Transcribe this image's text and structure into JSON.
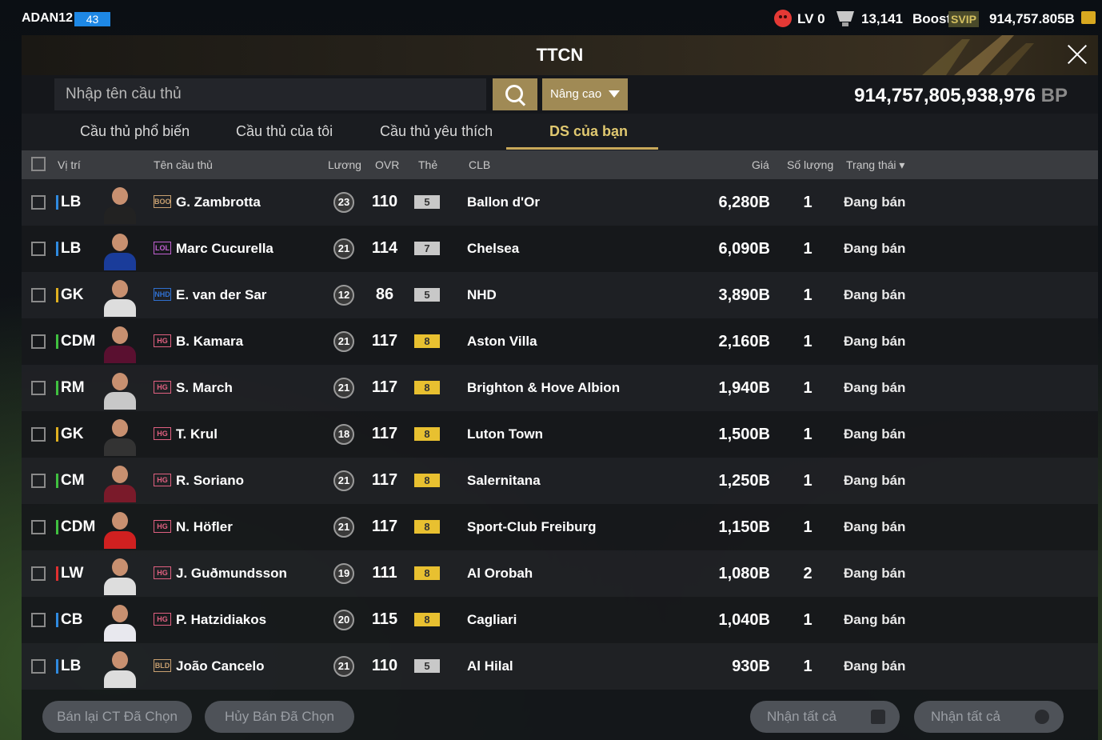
{
  "topbar": {
    "username": "ADAN12",
    "user_level": "43",
    "lv_text": "LV 0",
    "trophy_value": "13,141",
    "boost_label": "Boost",
    "svip_badge": "SVIP",
    "bp_balance": "914,757.805B",
    "icons": [
      "angry-face-icon",
      "trophy-icon",
      "bp-coin-icon"
    ]
  },
  "modal": {
    "title": "TTCN",
    "search": {
      "placeholder": "Nhập tên cầu thủ",
      "advanced_label": "Nâng cao",
      "bp_total": "914,757,805,938,976",
      "bp_unit": "BP"
    },
    "tabs": [
      {
        "label": "Cầu thủ phổ biến"
      },
      {
        "label": "Cầu thủ của tôi"
      },
      {
        "label": "Cầu thủ yêu thích"
      },
      {
        "label": "DS của bạn"
      }
    ],
    "active_tab": "DS của bạn",
    "columns": {
      "position": "Vị trí",
      "name": "Tên cầu thủ",
      "wage": "Lương",
      "ovr": "OVR",
      "card": "Thẻ",
      "club": "CLB",
      "price": "Giá",
      "quantity": "Số lượng",
      "status": "Trạng thái"
    },
    "rows": [
      {
        "position": "LB",
        "pos_color": "#2f8ae0",
        "season": "BOO",
        "season_color": "#c8a070",
        "name": "G. Zambrotta",
        "wage": "23",
        "ovr": "110",
        "card": "5",
        "card_color": "#c8c8c8",
        "club": "Ballon d'Or",
        "price": "6,280B",
        "qty": "1",
        "status": "Đang bán"
      },
      {
        "position": "LB",
        "pos_color": "#2f8ae0",
        "season": "LOL",
        "season_color": "#c060d0",
        "name": "Marc Cucurella",
        "wage": "21",
        "ovr": "114",
        "card": "7",
        "card_color": "#c8c8c8",
        "club": "Chelsea",
        "price": "6,090B",
        "qty": "1",
        "status": "Đang bán"
      },
      {
        "position": "GK",
        "pos_color": "#e0b020",
        "season": "NHD",
        "season_color": "#3070d0",
        "name": "E. van der Sar",
        "wage": "12",
        "ovr": "86",
        "card": "5",
        "card_color": "#c8c8c8",
        "club": "NHD",
        "price": "3,890B",
        "qty": "1",
        "status": "Đang bán"
      },
      {
        "position": "CDM",
        "pos_color": "#40c040",
        "season": "HG",
        "season_color": "#e06080",
        "name": "B. Kamara",
        "wage": "21",
        "ovr": "117",
        "card": "8",
        "card_color": "#e8c030",
        "club": "Aston Villa",
        "price": "2,160B",
        "qty": "1",
        "status": "Đang bán"
      },
      {
        "position": "RM",
        "pos_color": "#40c040",
        "season": "HG",
        "season_color": "#e06080",
        "name": "S. March",
        "wage": "21",
        "ovr": "117",
        "card": "8",
        "card_color": "#e8c030",
        "club": "Brighton & Hove Albion",
        "price": "1,940B",
        "qty": "1",
        "status": "Đang bán"
      },
      {
        "position": "GK",
        "pos_color": "#e0b020",
        "season": "HG",
        "season_color": "#e06080",
        "name": "T. Krul",
        "wage": "18",
        "ovr": "117",
        "card": "8",
        "card_color": "#e8c030",
        "club": "Luton Town",
        "price": "1,500B",
        "qty": "1",
        "status": "Đang bán"
      },
      {
        "position": "CM",
        "pos_color": "#40c040",
        "season": "HG",
        "season_color": "#e06080",
        "name": "R. Soriano",
        "wage": "21",
        "ovr": "117",
        "card": "8",
        "card_color": "#e8c030",
        "club": "Salernitana",
        "price": "1,250B",
        "qty": "1",
        "status": "Đang bán"
      },
      {
        "position": "CDM",
        "pos_color": "#40c040",
        "season": "HG",
        "season_color": "#e06080",
        "name": "N. Höfler",
        "wage": "21",
        "ovr": "117",
        "card": "8",
        "card_color": "#e8c030",
        "club": "Sport-Club Freiburg",
        "price": "1,150B",
        "qty": "1",
        "status": "Đang bán"
      },
      {
        "position": "LW",
        "pos_color": "#e03030",
        "season": "HG",
        "season_color": "#e06080",
        "name": "J. Guðmundsson",
        "wage": "19",
        "ovr": "111",
        "card": "8",
        "card_color": "#e8c030",
        "club": "Al Orobah",
        "price": "1,080B",
        "qty": "2",
        "status": "Đang bán"
      },
      {
        "position": "CB",
        "pos_color": "#2f8ae0",
        "season": "HG",
        "season_color": "#e06080",
        "name": "P. Hatzidiakos",
        "wage": "20",
        "ovr": "115",
        "card": "8",
        "card_color": "#e8c030",
        "club": "Cagliari",
        "price": "1,040B",
        "qty": "1",
        "status": "Đang bán"
      },
      {
        "position": "LB",
        "pos_color": "#2f8ae0",
        "season": "BLD",
        "season_color": "#c8a070",
        "name": "João Cancelo",
        "wage": "21",
        "ovr": "110",
        "card": "5",
        "card_color": "#c8c8c8",
        "club": "Al Hilal",
        "price": "930B",
        "qty": "1",
        "status": "Đang bán"
      }
    ],
    "footer": {
      "resell_label": "Bán lại CT Đã Chọn",
      "cancel_label": "Hủy Bán Đã Chọn",
      "receive_players_label": "Nhận tất cả",
      "receive_bp_label": "Nhận tất cả"
    }
  },
  "colors": {
    "accent": "#a08a55",
    "active_tab": "#e0c870"
  }
}
